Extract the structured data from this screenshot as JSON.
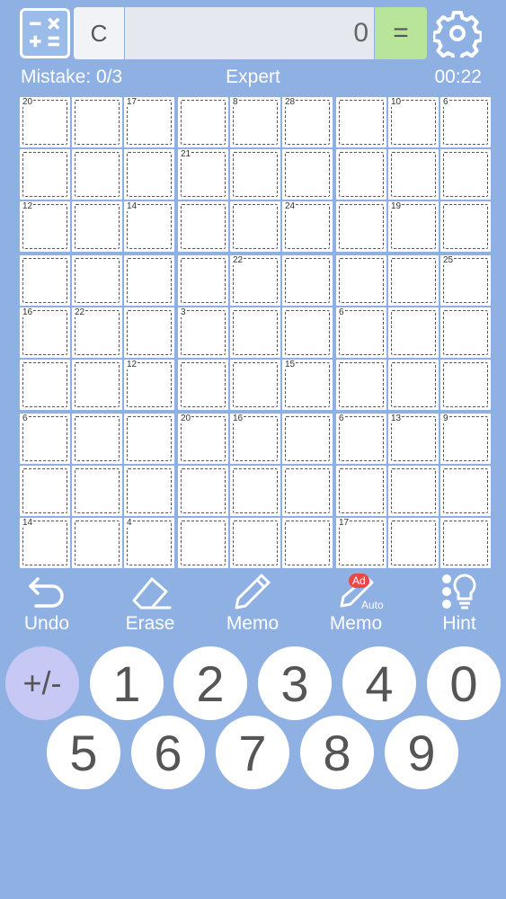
{
  "topbar": {
    "calculator_icon": "calculator-icon",
    "clear_label": "C",
    "display_value": "0",
    "equals_label": "=",
    "settings_icon": "gear-icon"
  },
  "status": {
    "mistakes": "Mistake: 0/3",
    "difficulty": "Expert",
    "timer": "00:22"
  },
  "board": {
    "size": 9,
    "cage_sums": [
      {
        "row": 0,
        "col": 0,
        "sum": "20"
      },
      {
        "row": 0,
        "col": 2,
        "sum": "17"
      },
      {
        "row": 0,
        "col": 4,
        "sum": "8"
      },
      {
        "row": 0,
        "col": 5,
        "sum": "28"
      },
      {
        "row": 0,
        "col": 7,
        "sum": "10"
      },
      {
        "row": 0,
        "col": 8,
        "sum": "6"
      },
      {
        "row": 1,
        "col": 3,
        "sum": "21"
      },
      {
        "row": 2,
        "col": 0,
        "sum": "12"
      },
      {
        "row": 2,
        "col": 2,
        "sum": "14"
      },
      {
        "row": 2,
        "col": 5,
        "sum": "24"
      },
      {
        "row": 2,
        "col": 7,
        "sum": "19"
      },
      {
        "row": 3,
        "col": 4,
        "sum": "22"
      },
      {
        "row": 3,
        "col": 8,
        "sum": "25"
      },
      {
        "row": 4,
        "col": 0,
        "sum": "16"
      },
      {
        "row": 4,
        "col": 1,
        "sum": "22"
      },
      {
        "row": 4,
        "col": 3,
        "sum": "3"
      },
      {
        "row": 4,
        "col": 6,
        "sum": "6"
      },
      {
        "row": 5,
        "col": 2,
        "sum": "12"
      },
      {
        "row": 5,
        "col": 5,
        "sum": "15"
      },
      {
        "row": 6,
        "col": 0,
        "sum": "6"
      },
      {
        "row": 6,
        "col": 3,
        "sum": "20"
      },
      {
        "row": 6,
        "col": 4,
        "sum": "16"
      },
      {
        "row": 6,
        "col": 6,
        "sum": "6"
      },
      {
        "row": 6,
        "col": 7,
        "sum": "13"
      },
      {
        "row": 6,
        "col": 8,
        "sum": "9"
      },
      {
        "row": 8,
        "col": 0,
        "sum": "14"
      },
      {
        "row": 8,
        "col": 2,
        "sum": "4"
      },
      {
        "row": 8,
        "col": 6,
        "sum": "17"
      }
    ]
  },
  "tools": [
    {
      "name": "undo",
      "label": "Undo",
      "icon": "undo-icon"
    },
    {
      "name": "erase",
      "label": "Erase",
      "icon": "eraser-icon"
    },
    {
      "name": "memo",
      "label": "Memo",
      "icon": "pencil-icon"
    },
    {
      "name": "auto-memo",
      "label": "Memo",
      "icon": "auto-pencil-icon",
      "badge": "Ad",
      "sub": "Auto"
    },
    {
      "name": "hint",
      "label": "Hint",
      "icon": "lightbulb-icon"
    }
  ],
  "keypad": {
    "row1": [
      "+/-",
      "1",
      "2",
      "3",
      "4",
      "0"
    ],
    "row2": [
      "5",
      "6",
      "7",
      "8",
      "9"
    ]
  },
  "colors": {
    "background": "#8fb0e3",
    "equals": "#b9e59b",
    "sign_key": "#c7c8f3",
    "ad_badge": "#e8484b"
  }
}
